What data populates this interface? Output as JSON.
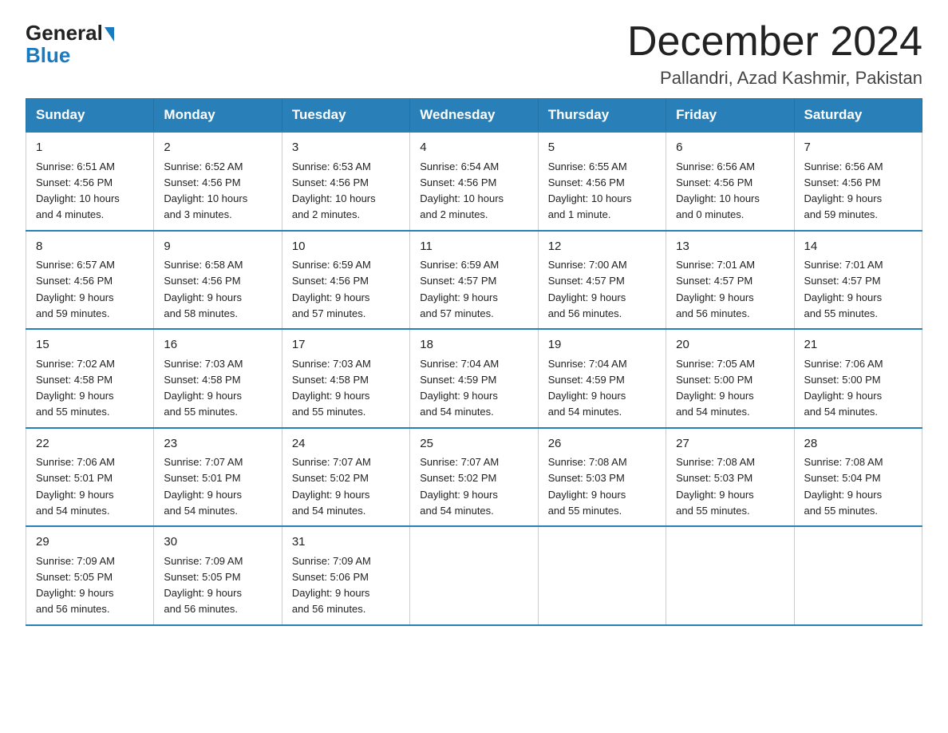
{
  "header": {
    "logo_general": "General",
    "logo_blue": "Blue",
    "title": "December 2024",
    "subtitle": "Pallandri, Azad Kashmir, Pakistan"
  },
  "days_of_week": [
    "Sunday",
    "Monday",
    "Tuesday",
    "Wednesday",
    "Thursday",
    "Friday",
    "Saturday"
  ],
  "weeks": [
    [
      {
        "day": "1",
        "info": "Sunrise: 6:51 AM\nSunset: 4:56 PM\nDaylight: 10 hours\nand 4 minutes."
      },
      {
        "day": "2",
        "info": "Sunrise: 6:52 AM\nSunset: 4:56 PM\nDaylight: 10 hours\nand 3 minutes."
      },
      {
        "day": "3",
        "info": "Sunrise: 6:53 AM\nSunset: 4:56 PM\nDaylight: 10 hours\nand 2 minutes."
      },
      {
        "day": "4",
        "info": "Sunrise: 6:54 AM\nSunset: 4:56 PM\nDaylight: 10 hours\nand 2 minutes."
      },
      {
        "day": "5",
        "info": "Sunrise: 6:55 AM\nSunset: 4:56 PM\nDaylight: 10 hours\nand 1 minute."
      },
      {
        "day": "6",
        "info": "Sunrise: 6:56 AM\nSunset: 4:56 PM\nDaylight: 10 hours\nand 0 minutes."
      },
      {
        "day": "7",
        "info": "Sunrise: 6:56 AM\nSunset: 4:56 PM\nDaylight: 9 hours\nand 59 minutes."
      }
    ],
    [
      {
        "day": "8",
        "info": "Sunrise: 6:57 AM\nSunset: 4:56 PM\nDaylight: 9 hours\nand 59 minutes."
      },
      {
        "day": "9",
        "info": "Sunrise: 6:58 AM\nSunset: 4:56 PM\nDaylight: 9 hours\nand 58 minutes."
      },
      {
        "day": "10",
        "info": "Sunrise: 6:59 AM\nSunset: 4:56 PM\nDaylight: 9 hours\nand 57 minutes."
      },
      {
        "day": "11",
        "info": "Sunrise: 6:59 AM\nSunset: 4:57 PM\nDaylight: 9 hours\nand 57 minutes."
      },
      {
        "day": "12",
        "info": "Sunrise: 7:00 AM\nSunset: 4:57 PM\nDaylight: 9 hours\nand 56 minutes."
      },
      {
        "day": "13",
        "info": "Sunrise: 7:01 AM\nSunset: 4:57 PM\nDaylight: 9 hours\nand 56 minutes."
      },
      {
        "day": "14",
        "info": "Sunrise: 7:01 AM\nSunset: 4:57 PM\nDaylight: 9 hours\nand 55 minutes."
      }
    ],
    [
      {
        "day": "15",
        "info": "Sunrise: 7:02 AM\nSunset: 4:58 PM\nDaylight: 9 hours\nand 55 minutes."
      },
      {
        "day": "16",
        "info": "Sunrise: 7:03 AM\nSunset: 4:58 PM\nDaylight: 9 hours\nand 55 minutes."
      },
      {
        "day": "17",
        "info": "Sunrise: 7:03 AM\nSunset: 4:58 PM\nDaylight: 9 hours\nand 55 minutes."
      },
      {
        "day": "18",
        "info": "Sunrise: 7:04 AM\nSunset: 4:59 PM\nDaylight: 9 hours\nand 54 minutes."
      },
      {
        "day": "19",
        "info": "Sunrise: 7:04 AM\nSunset: 4:59 PM\nDaylight: 9 hours\nand 54 minutes."
      },
      {
        "day": "20",
        "info": "Sunrise: 7:05 AM\nSunset: 5:00 PM\nDaylight: 9 hours\nand 54 minutes."
      },
      {
        "day": "21",
        "info": "Sunrise: 7:06 AM\nSunset: 5:00 PM\nDaylight: 9 hours\nand 54 minutes."
      }
    ],
    [
      {
        "day": "22",
        "info": "Sunrise: 7:06 AM\nSunset: 5:01 PM\nDaylight: 9 hours\nand 54 minutes."
      },
      {
        "day": "23",
        "info": "Sunrise: 7:07 AM\nSunset: 5:01 PM\nDaylight: 9 hours\nand 54 minutes."
      },
      {
        "day": "24",
        "info": "Sunrise: 7:07 AM\nSunset: 5:02 PM\nDaylight: 9 hours\nand 54 minutes."
      },
      {
        "day": "25",
        "info": "Sunrise: 7:07 AM\nSunset: 5:02 PM\nDaylight: 9 hours\nand 54 minutes."
      },
      {
        "day": "26",
        "info": "Sunrise: 7:08 AM\nSunset: 5:03 PM\nDaylight: 9 hours\nand 55 minutes."
      },
      {
        "day": "27",
        "info": "Sunrise: 7:08 AM\nSunset: 5:03 PM\nDaylight: 9 hours\nand 55 minutes."
      },
      {
        "day": "28",
        "info": "Sunrise: 7:08 AM\nSunset: 5:04 PM\nDaylight: 9 hours\nand 55 minutes."
      }
    ],
    [
      {
        "day": "29",
        "info": "Sunrise: 7:09 AM\nSunset: 5:05 PM\nDaylight: 9 hours\nand 56 minutes."
      },
      {
        "day": "30",
        "info": "Sunrise: 7:09 AM\nSunset: 5:05 PM\nDaylight: 9 hours\nand 56 minutes."
      },
      {
        "day": "31",
        "info": "Sunrise: 7:09 AM\nSunset: 5:06 PM\nDaylight: 9 hours\nand 56 minutes."
      },
      null,
      null,
      null,
      null
    ]
  ]
}
